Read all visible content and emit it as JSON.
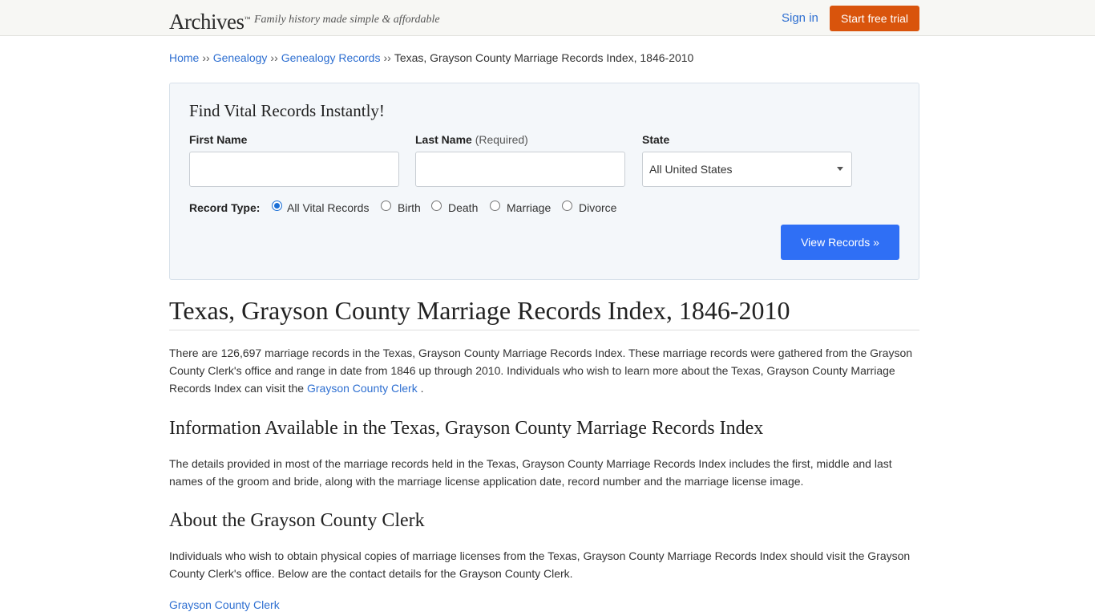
{
  "header": {
    "logo": "Archives",
    "logo_mark": "™",
    "tagline": "Family history made simple & affordable",
    "sign_in": "Sign in",
    "start_trial": "Start free trial"
  },
  "breadcrumb": {
    "items": [
      "Home",
      "Genealogy",
      "Genealogy Records"
    ],
    "separator": "››",
    "current": "Texas, Grayson County Marriage Records Index, 1846-2010"
  },
  "search": {
    "title": "Find Vital Records Instantly!",
    "first_name_label": "First Name",
    "last_name_label": "Last Name",
    "last_name_required": "(Required)",
    "state_label": "State",
    "state_value": "All United States",
    "record_type_label": "Record Type:",
    "record_types": [
      "All Vital Records",
      "Birth",
      "Death",
      "Marriage",
      "Divorce"
    ],
    "selected_record_type": "All Vital Records",
    "submit": "View Records »"
  },
  "article": {
    "title": "Texas, Grayson County Marriage Records Index, 1846-2010",
    "intro_before_link": "There are 126,697 marriage records in the Texas, Grayson County Marriage Records Index. These marriage records were gathered from the Grayson County Clerk's office and range in date from 1846 up through 2010. Individuals who wish to learn more about the Texas, Grayson County Marriage Records Index can visit the ",
    "intro_link": "Grayson County Clerk",
    "intro_after_link": " .",
    "section1_title": "Information Available in the Texas, Grayson County Marriage Records Index",
    "section1_text": "The details provided in most of the marriage records held in the Texas, Grayson County Marriage Records Index includes the first, middle and last names of the groom and bride, along with the marriage license application date, record number and the marriage license image.",
    "section2_title": "About the Grayson County Clerk",
    "section2_text": "Individuals who wish to obtain physical copies of marriage licenses from the Texas, Grayson County Marriage Records Index should visit the Grayson County Clerk's office. Below are the contact details for the Grayson County Clerk.",
    "clerk_link": "Grayson County Clerk"
  },
  "colors": {
    "accent_orange": "#d9540c",
    "link_blue": "#2e6fd1",
    "button_blue": "#2f6ff5"
  }
}
